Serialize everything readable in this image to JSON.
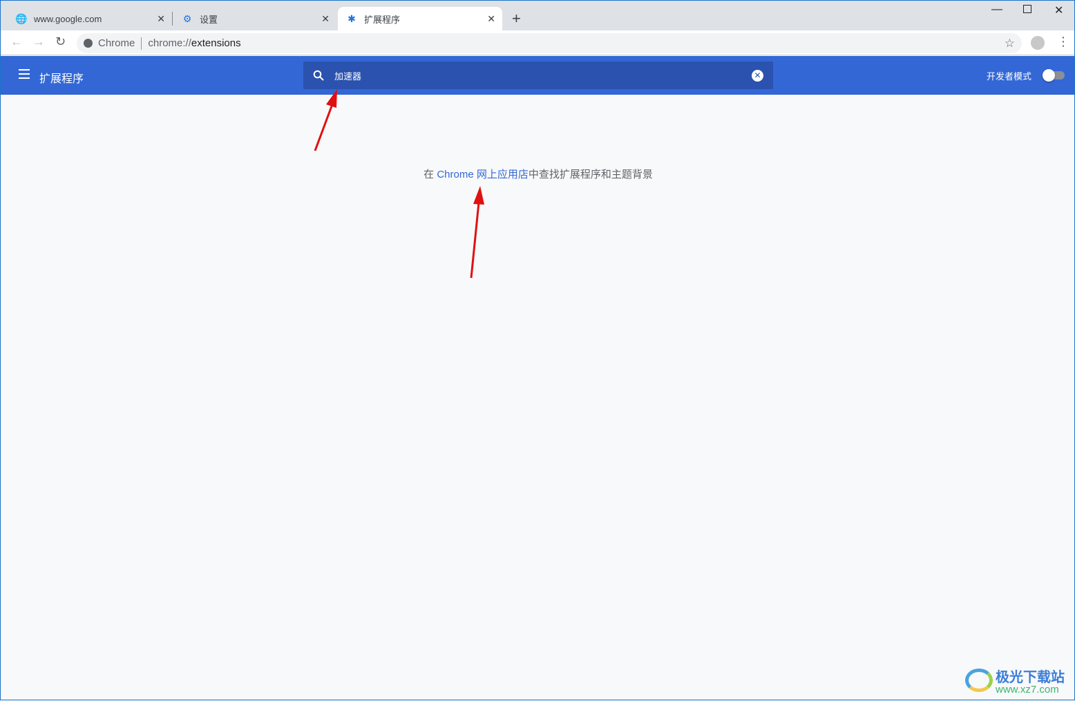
{
  "tabs": [
    {
      "title": "www.google.com",
      "icon": "globe-icon"
    },
    {
      "title": "设置",
      "icon": "gear-icon"
    },
    {
      "title": "扩展程序",
      "icon": "puzzle-icon",
      "active": true
    }
  ],
  "omnibox": {
    "site": "Chrome",
    "scheme": "chrome://",
    "path": "extensions"
  },
  "header": {
    "title": "扩展程序",
    "search_value": "加速器",
    "dev_mode_label": "开发者模式",
    "dev_mode_on": false
  },
  "main": {
    "prefix": "在 ",
    "link": "Chrome 网上应用店",
    "suffix": "中查找扩展程序和主题背景"
  },
  "watermark": {
    "name": "极光下载站",
    "url": "www.xz7.com"
  },
  "colors": {
    "accent": "#3367d6",
    "search_bg": "#2a52ae",
    "arrow": "#e01010"
  }
}
